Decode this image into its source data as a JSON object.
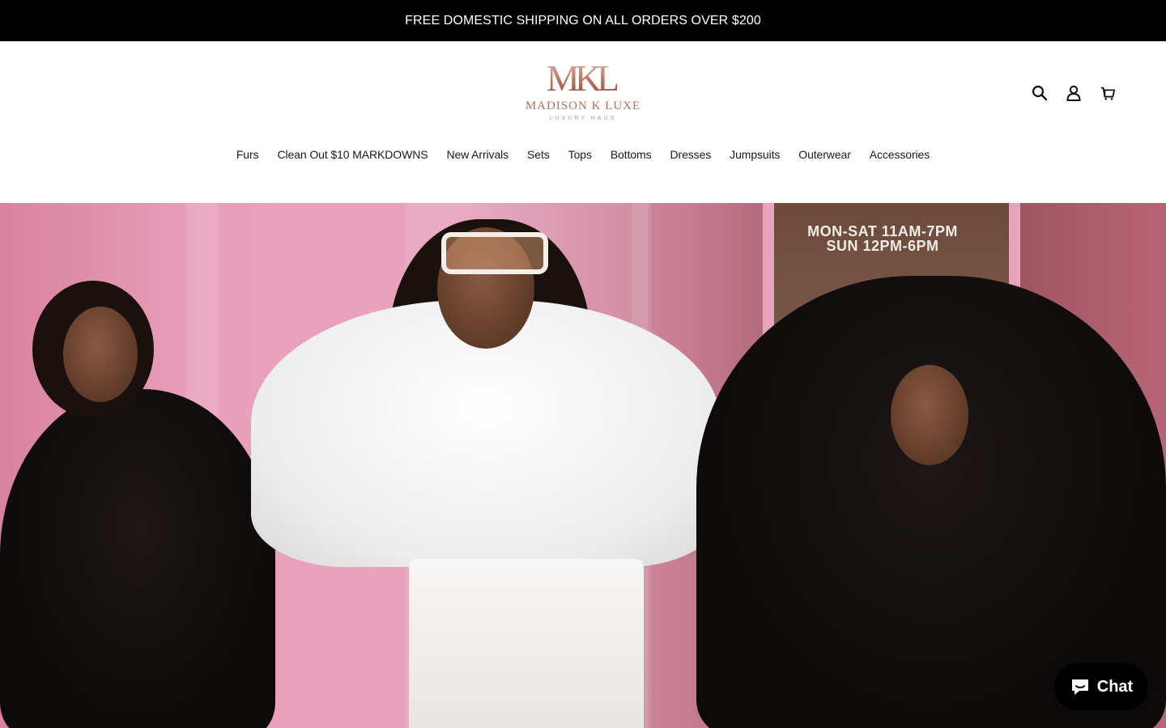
{
  "announcement": {
    "text": "FREE DOMESTIC SHIPPING ON ALL ORDERS OVER $200"
  },
  "logo": {
    "mark": "MKL",
    "name": "MADISON K LUXE",
    "tagline": "LUXURY HAUS"
  },
  "header_icons": [
    "search-icon",
    "account-icon",
    "cart-icon"
  ],
  "nav": {
    "items": [
      {
        "label": "Furs"
      },
      {
        "label": "Clean Out $10 MARKDOWNS"
      },
      {
        "label": "New Arrivals"
      },
      {
        "label": "Sets"
      },
      {
        "label": "Tops"
      },
      {
        "label": "Bottoms"
      },
      {
        "label": "Dresses"
      },
      {
        "label": "Jumpsuits"
      },
      {
        "label": "Outerwear"
      },
      {
        "label": "Accessories"
      }
    ]
  },
  "hero": {
    "sign_line1": "MON-SAT 11AM-7PM",
    "sign_line2": "SUN 12PM-6PM"
  },
  "chat": {
    "label": "Chat",
    "icon": "chat-bubble-icon"
  },
  "colors": {
    "announcement_bg": "#000000",
    "brand_rose": "#b06e5c",
    "chat_bg": "#000000"
  }
}
